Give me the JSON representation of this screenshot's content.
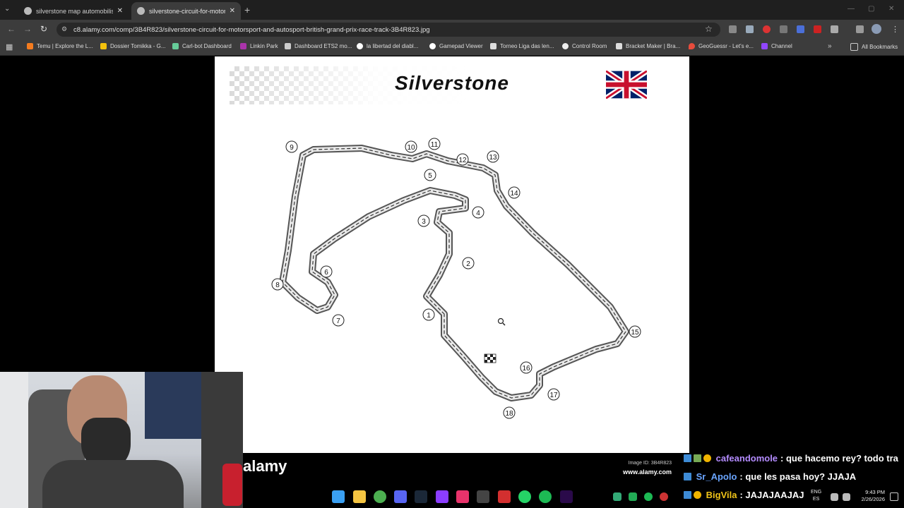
{
  "browser": {
    "tabs": [
      {
        "title": "silverstone map automobilist - ",
        "active": false
      },
      {
        "title": "silverstone-circuit-for-motorsp",
        "active": true
      }
    ],
    "url": "c8.alamy.com/comp/3B4R823/silverstone-circuit-for-motorsport-and-autosport-british-grand-prix-race-track-3B4R823.jpg",
    "bookmarks": [
      "Temu | Explore the L...",
      "Dossier Tomikka - G...",
      "Carl-bot Dashboard",
      "Linkin Park",
      "Dashboard ETS2 mo...",
      "la libertad del diabl...",
      "Gamepad Viewer",
      "Torneo Liga das len...",
      "Control Room",
      "Bracket Maker | Bra...",
      "GeoGuessr - Let's e...",
      "Channel"
    ],
    "all_bookmarks": "All Bookmarks"
  },
  "image": {
    "title": "Silverstone",
    "turns": [
      "1",
      "2",
      "3",
      "4",
      "5",
      "6",
      "7",
      "8",
      "9",
      "10",
      "11",
      "12",
      "13",
      "14",
      "15",
      "16",
      "17",
      "18"
    ],
    "watermark": "alamy",
    "image_id": "Image ID: 3B4R823",
    "website": "www.alamy.com"
  },
  "chat": [
    {
      "user": "cafeandomole",
      "message": ": que hacemo rey? todo tra",
      "color": "#b48cff"
    },
    {
      "user": "Sr_Apolo",
      "message": ": que les pasa hoy? JJAJA",
      "color": "#6aa5ff"
    },
    {
      "user": "BigVila",
      "message": ": JAJAJAAJAJ",
      "color": "#f0c419"
    }
  ],
  "taskbar": {
    "lang": "ENG",
    "lang_sub": "ES",
    "time": "9:43 PM",
    "date": "2/26/2026"
  }
}
